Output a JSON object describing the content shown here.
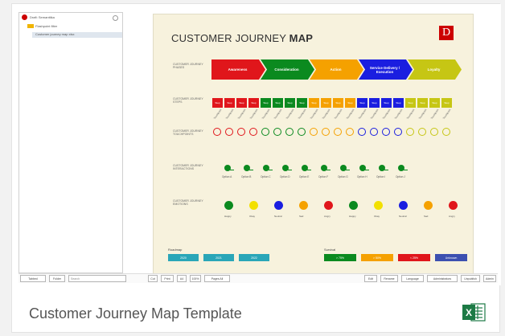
{
  "colors": {
    "red": "#e0161b",
    "green": "#0b8a1f",
    "orange": "#f5a100",
    "blue": "#1a1ee0",
    "lime": "#c6c614",
    "excel": "#1d7a45",
    "logo_red": "#cc0000"
  },
  "tree": {
    "items": [
      {
        "label": "Draft: Semanttika",
        "icon": "pin-icon"
      },
      {
        "label": "Flashpoint filter",
        "icon": "folder-icon"
      },
      {
        "label": "Customer journey map xlsx",
        "icon": "sheet-icon"
      }
    ]
  },
  "sheet": {
    "title_main": "CUSTOMER JOURNEY ",
    "title_bold": "MAP",
    "logo": "D",
    "row_labels": {
      "phases": "CUSTOMER JOURNEY PHASES",
      "steps": "CUSTOMER JOURNEY STEPS",
      "touchpoints": "CUSTOMER JOURNEY TOUCHPOINTS",
      "interactions": "CUSTOMER JOURNEY INTERACTIONS",
      "emotions": "CUSTOMER JOURNEY EMOTIONS"
    },
    "phases": [
      {
        "label": "Awareness",
        "color": "#e0161b"
      },
      {
        "label": "Consideration",
        "color": "#0b8a1f"
      },
      {
        "label": "Action",
        "color": "#f5a100"
      },
      {
        "label": "Service Delivery / Execution",
        "color": "#1a1ee0"
      },
      {
        "label": "Loyalty",
        "color": "#c6c614"
      }
    ],
    "steps_per_phase": 4,
    "step_label": "Step",
    "touchpoint_label": "Touchpoint",
    "interactions": [
      "Option A",
      "Option B",
      "Option C",
      "Option D",
      "Option E",
      "Option F",
      "Option G",
      "Option H",
      "Option I",
      "Option J"
    ],
    "emotions": [
      {
        "label": "Happy",
        "color": "#0b8a1f"
      },
      {
        "label": "Okay",
        "color": "#f2e000"
      },
      {
        "label": "Neutral",
        "color": "#1a1ee0"
      },
      {
        "label": "Sad",
        "color": "#f5a100"
      },
      {
        "label": "Angry",
        "color": "#e0161b"
      },
      {
        "label": "Happy",
        "color": "#0b8a1f"
      },
      {
        "label": "Okay",
        "color": "#f2e000"
      },
      {
        "label": "Neutral",
        "color": "#1a1ee0"
      },
      {
        "label": "Sad",
        "color": "#f5a100"
      },
      {
        "label": "Angry",
        "color": "#e0161b"
      }
    ],
    "legend_left_title": "Roadmap",
    "legend_left": [
      "2020",
      "2021",
      "2022"
    ],
    "legend_right_title": "Survival",
    "legend_right": [
      {
        "label": "> 75%",
        "color": "#0b8a1f"
      },
      {
        "label": "> 50%",
        "color": "#f5a100"
      },
      {
        "label": "< 25%",
        "color": "#e0161b"
      },
      {
        "label": "Unknown",
        "color": "#3c50b0"
      }
    ]
  },
  "toolbar": {
    "left_buttons": [
      "Tabbed",
      "Folder"
    ],
    "search_placeholder": "Search",
    "mid_buttons": [
      "Cut",
      "Print",
      "A4",
      "100%",
      "Pages All"
    ],
    "right_buttons": [
      "Edit",
      "Rename",
      "Language",
      "Administrators",
      "Unpublish",
      "Admin"
    ]
  },
  "caption": "Customer Journey Map Template"
}
